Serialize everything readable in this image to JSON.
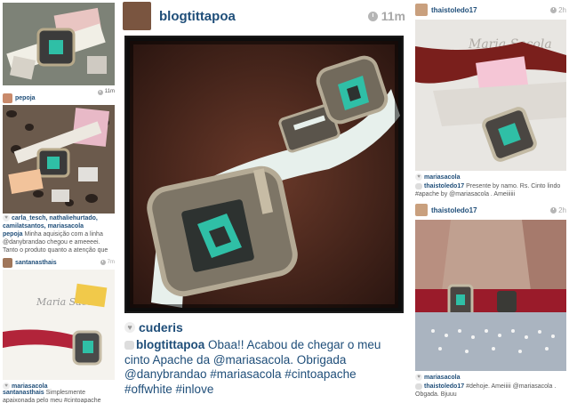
{
  "colors": {
    "link": "#1f4e79",
    "muted": "#a8a8a8",
    "text": "#555555"
  },
  "left": {
    "post1": {
      "time": "11m"
    },
    "post2": {
      "username": "pepoja",
      "likes": "carla_tesch, nathaliehurtado, camilatsantos, mariasacola",
      "comment_user": "pepoja",
      "comment_text": "Minha aquisição com a linha @danybrandao chegou e ameeeei. Tanto o produto quanto a atenção que ela me deu. Viva a @mariasacola !!!"
    },
    "post3": {
      "username": "santanasthais",
      "time": "7m",
      "photo_logo": "Maria Sacola",
      "likes": "mariasacola",
      "comment_user": "santanasthais",
      "comment_text": "Simplesmente apaixonada pelo meu #cintoapache @mariasacola"
    }
  },
  "center": {
    "username": "blogtittapoa",
    "time": "11m",
    "likes": "cuderis",
    "comment_user": "blogtittapoa",
    "comment_text": "Obaa!! Acabou de chegar o meu cinto Apache da @mariasacola. Obrigada @danybrandao #mariasacola #cintoapache #offwhite #inlove"
  },
  "right": {
    "post1": {
      "username": "thaistoledo17",
      "time": "2h",
      "photo_logo": "Maria Sacola",
      "likes": "mariasacola",
      "comment_user": "thaistoledo17",
      "comment_text": "Presente by namo. Rs. Cinto lindo #apache by @mariasacola . Ameiiiiii"
    },
    "post2": {
      "username": "thaistoledo17",
      "time": "2h",
      "likes": "mariasacola",
      "comment_user": "thaistoledo17",
      "comment_text": "#dehoje. Ameiiiii @mariasacola . Obgada. Bjuuu"
    }
  }
}
